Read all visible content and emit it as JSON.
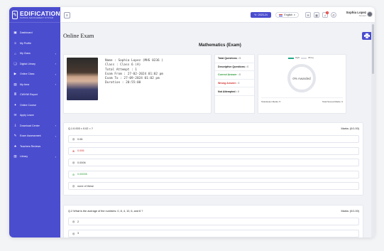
{
  "brand": {
    "name": "EDIFICATION",
    "tagline": "SCHOOL MANAGEMENT SYSTEM",
    "color": "#4b4dcf"
  },
  "sidebar": {
    "items": [
      {
        "label": "Dashboard",
        "icon": "dashboard-icon",
        "chevron": ""
      },
      {
        "label": "My Profile",
        "icon": "user-icon",
        "chevron": ""
      },
      {
        "label": "My Class",
        "icon": "home-icon",
        "chevron": "›"
      },
      {
        "label": "Digital Library",
        "icon": "book-icon",
        "chevron": "›"
      },
      {
        "label": "Online Class",
        "icon": "video-icon",
        "chevron": "›"
      },
      {
        "label": "My Area",
        "icon": "folder-icon",
        "chevron": "›"
      },
      {
        "label": "CW/HW Report",
        "icon": "report-icon",
        "chevron": ""
      },
      {
        "label": "Online Course",
        "icon": "course-icon",
        "chevron": ""
      },
      {
        "label": "Apply Leave",
        "icon": "leave-icon",
        "chevron": ""
      },
      {
        "label": "Download Center",
        "icon": "download-icon",
        "chevron": "›"
      },
      {
        "label": "Exam Assessment",
        "icon": "exam-icon",
        "chevron": "›"
      },
      {
        "label": "Teachers Reviews",
        "icon": "review-icon",
        "chevron": ""
      },
      {
        "label": "Library",
        "icon": "library-icon",
        "chevron": "›"
      }
    ]
  },
  "topbar": {
    "session": "Yr: 2023-24",
    "language": "English",
    "notification_count": "2",
    "user_name": "Sophia Lopez",
    "user_role": "Student"
  },
  "page": {
    "title": "Online Exam",
    "exam_title": "Mathematics (Exam)"
  },
  "student": {
    "name_line": "Name : Sophia Lopez (MHS 0236 )",
    "class_line": "Class : Class 6 (A)",
    "attempt_line": "Total Attempt : 1",
    "from_line": "Exam From : 27-02-2024 01:02 pm",
    "to_line": "Exam To : 27-09-2024 01:02 pm",
    "duration_line": "Duration : 20:55:00"
  },
  "stats": {
    "total_questions": {
      "label": "Total Questions :",
      "value": "5"
    },
    "descriptive": {
      "label": "Descriptive Questions :",
      "value": "0"
    },
    "correct": {
      "label": "Correct Answer :",
      "value": "0"
    },
    "wrong": {
      "label": "Wrong Answer :",
      "value": "0"
    },
    "not_attempted": {
      "label": "Not Attempted :",
      "value": "0"
    }
  },
  "result_chart": {
    "legend_right": "Right",
    "legend_wrong": "Wrong",
    "center_text": "0% Awarded",
    "total_exam_marks": "Total Exam Marks: 5",
    "total_scored_marks": "Total Scored Marks: 0",
    "right_color": "#22a889",
    "wrong_color": "#d9dbe3"
  },
  "questions": [
    {
      "head": "Q.1 0.003 × 0.02 = ?",
      "marks": "Marks: (0/1.00)",
      "options": [
        {
          "mark": "◎",
          "text": "0.06",
          "state": "normal"
        },
        {
          "mark": "⊗",
          "text": "0.006",
          "state": "wrong"
        },
        {
          "mark": "◎",
          "text": "0.0006",
          "state": "normal"
        },
        {
          "mark": "⊘",
          "text": "0.00006",
          "state": "right"
        },
        {
          "mark": "◎",
          "text": "none of these",
          "state": "normal"
        }
      ]
    },
    {
      "head": "Q.2 What is the average of the numbers: 0, 8, 4, 10, 6, and 8 ?",
      "marks": "Marks: (0/1.00)",
      "options": [
        {
          "mark": "◎",
          "text": "2",
          "state": "normal"
        },
        {
          "mark": "◎",
          "text": "3",
          "state": "normal"
        },
        {
          "mark": "◎",
          "text": "",
          "state": "normal"
        }
      ]
    }
  ]
}
